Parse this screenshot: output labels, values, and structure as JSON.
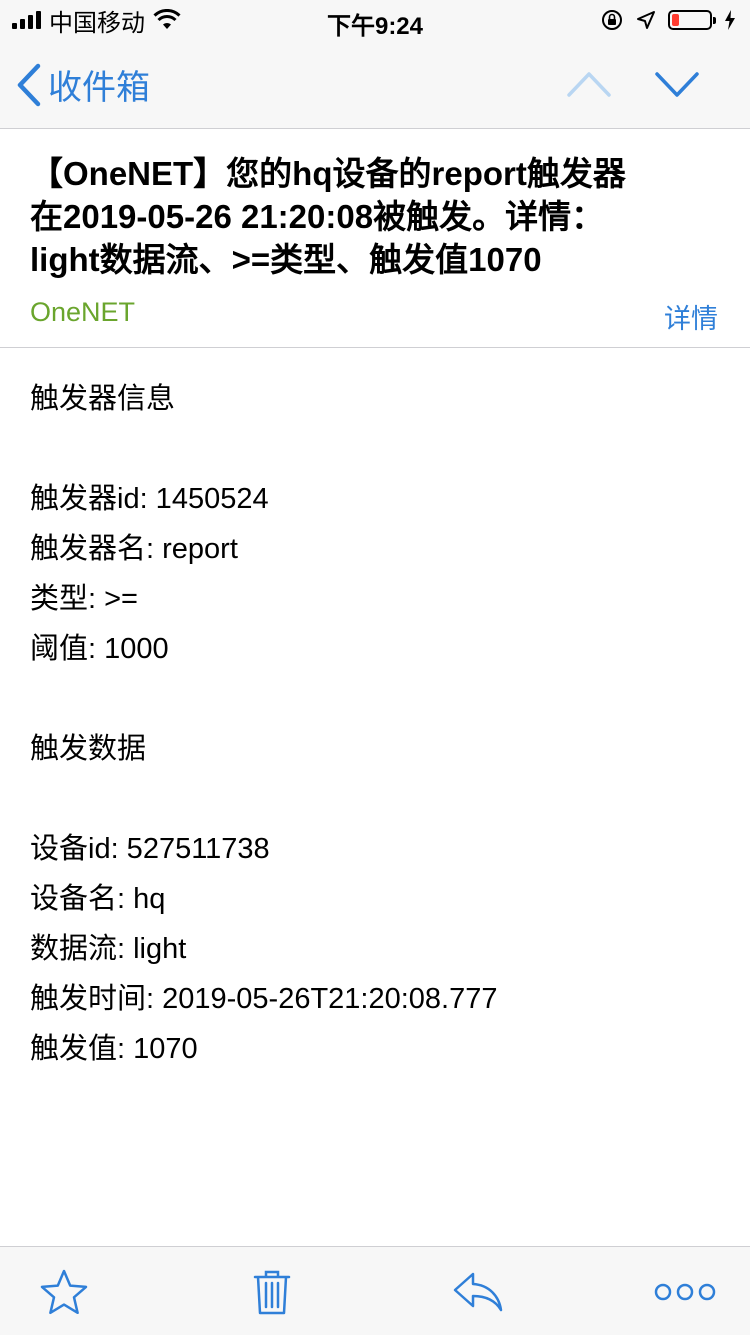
{
  "status_bar": {
    "carrier": "中国移动",
    "time": "下午9:24",
    "battery_level": 0.2,
    "battery_color": "#ff3b30"
  },
  "nav": {
    "back_label": "收件箱",
    "icons": [
      "chevron-left-icon",
      "chevron-up-icon",
      "chevron-down-icon"
    ],
    "accent": "#2f7fd8"
  },
  "email": {
    "subject_lines": [
      "【OneNET】您的hq设备的report触发器",
      "在2019-05-26 21:20:08被触发。详情：",
      "light数据流、>=类型、触发值1070"
    ],
    "sender": "OneNET",
    "sender_color": "#6aa52d",
    "details_label": "详情",
    "body_lines": [
      "触发器信息",
      "",
      "触发器id: 1450524",
      "触发器名: report",
      "类型: >=",
      "阈值: 1000",
      "",
      "触发数据",
      "",
      "设备id: 527511738",
      "设备名: hq",
      "数据流: light",
      "触发时间: 2019-05-26T21:20:08.777",
      "触发值: 1070"
    ]
  },
  "toolbar": {
    "icons": [
      "star-icon",
      "trash-icon",
      "reply-icon",
      "more-icon"
    ]
  }
}
